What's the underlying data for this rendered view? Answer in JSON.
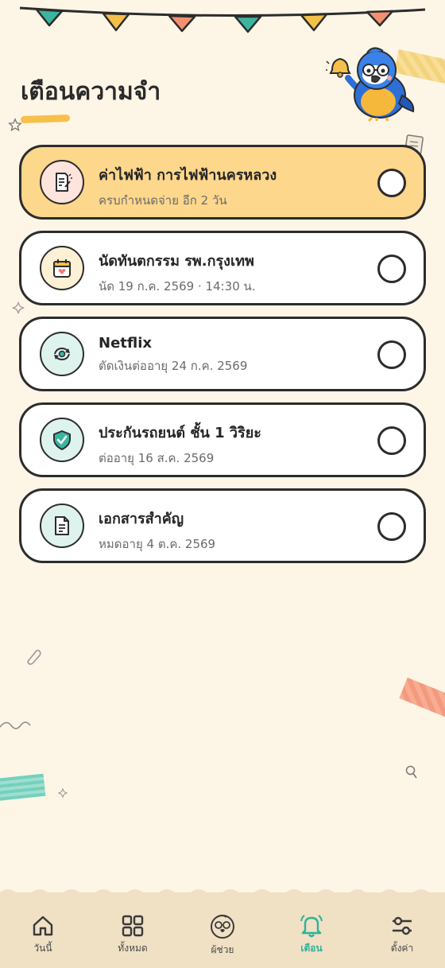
{
  "page": {
    "title": "เตือนความจำ"
  },
  "reminders": [
    {
      "title": "ค่าไฟฟ้า การไฟฟ้านครหลวง",
      "subtitle": "ครบกำหนดจ่าย อีก 2 วัน",
      "icon": "bill-icon",
      "highlight": true
    },
    {
      "title": "นัดทันตกรรม รพ.กรุงเทพ",
      "subtitle": "นัด 19 ก.ค. 2569 · 14:30 น.",
      "icon": "calendar-heart-icon",
      "highlight": false
    },
    {
      "title": "Netflix",
      "subtitle": "ตัดเงินต่ออายุ 24 ก.ค. 2569",
      "icon": "renew-icon",
      "highlight": false
    },
    {
      "title": "ประกันรถยนต์ ชั้น 1 วิริยะ",
      "subtitle": "ต่ออายุ 16 ส.ค. 2569",
      "icon": "shield-check-icon",
      "highlight": false
    },
    {
      "title": "เอกสารสำคัญ",
      "subtitle": "หมดอายุ 4 ต.ค. 2569",
      "icon": "document-icon",
      "highlight": false
    }
  ],
  "nav": {
    "items": [
      {
        "label": "วันนี้",
        "icon": "home-icon"
      },
      {
        "label": "ทั้งหมด",
        "icon": "grid-icon"
      },
      {
        "label": "ผู้ช่วย",
        "icon": "parrot-icon"
      },
      {
        "label": "เตือน",
        "icon": "bell-icon",
        "active": true
      },
      {
        "label": "ตั้งค่า",
        "icon": "sliders-icon"
      }
    ]
  },
  "colors": {
    "background": "#fdf5e6",
    "highlight_card": "#fdd78c",
    "accent": "#2bb39a",
    "bunting": [
      "#3bb5a0",
      "#f5c04a",
      "#f29072"
    ]
  }
}
